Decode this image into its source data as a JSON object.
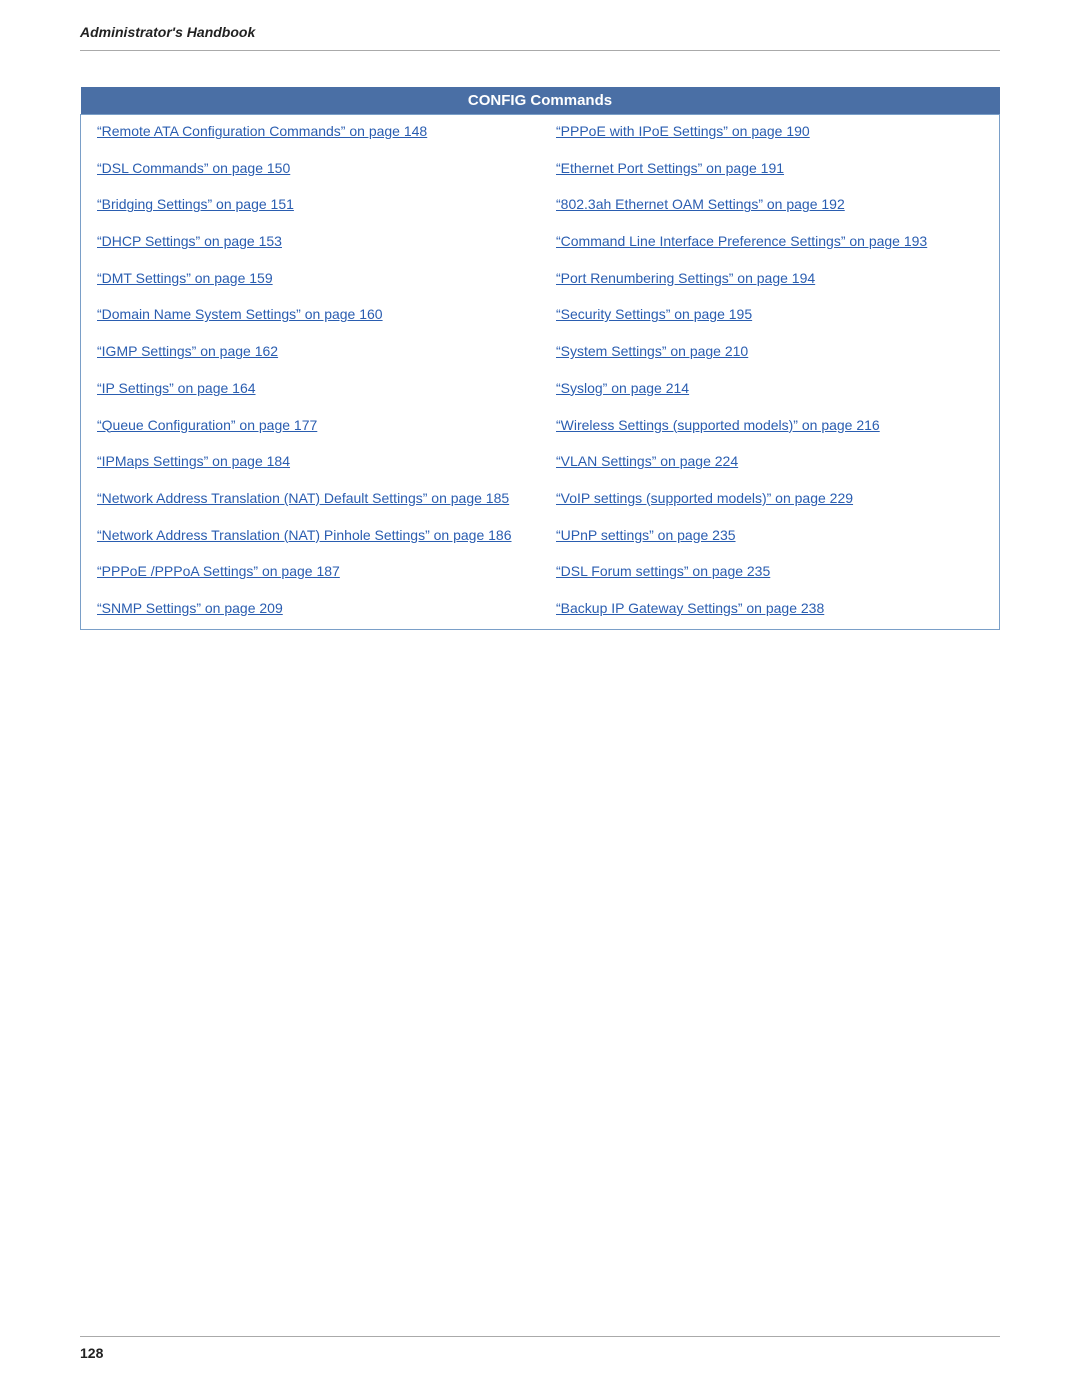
{
  "header": {
    "title": "Administrator's Handbook"
  },
  "table": {
    "heading": "CONFIG Commands",
    "left_column": [
      {
        "text": "“Remote ATA Configuration Commands” on page 148",
        "href": "#"
      },
      {
        "text": "“DSL Commands” on page 150",
        "href": "#"
      },
      {
        "text": "“Bridging Settings” on page 151",
        "href": "#"
      },
      {
        "text": "“DHCP Settings” on page 153",
        "href": "#"
      },
      {
        "text": "“DMT Settings” on page 159",
        "href": "#"
      },
      {
        "text": "“Domain Name System Settings” on page 160",
        "href": "#"
      },
      {
        "text": "“IGMP Settings” on page 162",
        "href": "#"
      },
      {
        "text": "“IP Settings” on page 164",
        "href": "#"
      },
      {
        "text": "“Queue Configuration” on page 177",
        "href": "#"
      },
      {
        "text": "“IPMaps Settings” on page 184",
        "href": "#"
      },
      {
        "text": "“Network Address Translation (NAT) Default Settings” on page 185",
        "href": "#"
      },
      {
        "text": "“Network Address Translation (NAT) Pinhole Settings” on page 186",
        "href": "#"
      },
      {
        "text": "“PPPoE /PPPoA Settings” on page 187",
        "href": "#"
      },
      {
        "text": "“SNMP Settings” on page 209",
        "href": "#"
      }
    ],
    "right_column": [
      {
        "text": "“PPPoE with IPoE Settings” on page 190",
        "href": "#"
      },
      {
        "text": "“Ethernet Port Settings” on page 191",
        "href": "#"
      },
      {
        "text": "“802.3ah Ethernet OAM Settings” on page 192",
        "href": "#"
      },
      {
        "text": "“Command Line Interface Preference Settings” on page 193",
        "href": "#"
      },
      {
        "text": "“Port Renumbering Settings” on page 194",
        "href": "#"
      },
      {
        "text": "“Security Settings” on page 195",
        "href": "#"
      },
      {
        "text": "“System Settings” on page 210",
        "href": "#"
      },
      {
        "text": "“Syslog” on page 214",
        "href": "#"
      },
      {
        "text": "“Wireless Settings (supported models)” on page 216",
        "href": "#"
      },
      {
        "text": "“VLAN Settings” on page 224",
        "href": "#"
      },
      {
        "text": "“VoIP settings (supported models)” on page 229",
        "href": "#"
      },
      {
        "text": "“UPnP settings” on page 235",
        "href": "#"
      },
      {
        "text": "“DSL Forum settings” on page 235",
        "href": "#"
      },
      {
        "text": "“Backup IP Gateway Settings” on page 238",
        "href": "#"
      }
    ]
  },
  "footer": {
    "page_number": "128"
  }
}
